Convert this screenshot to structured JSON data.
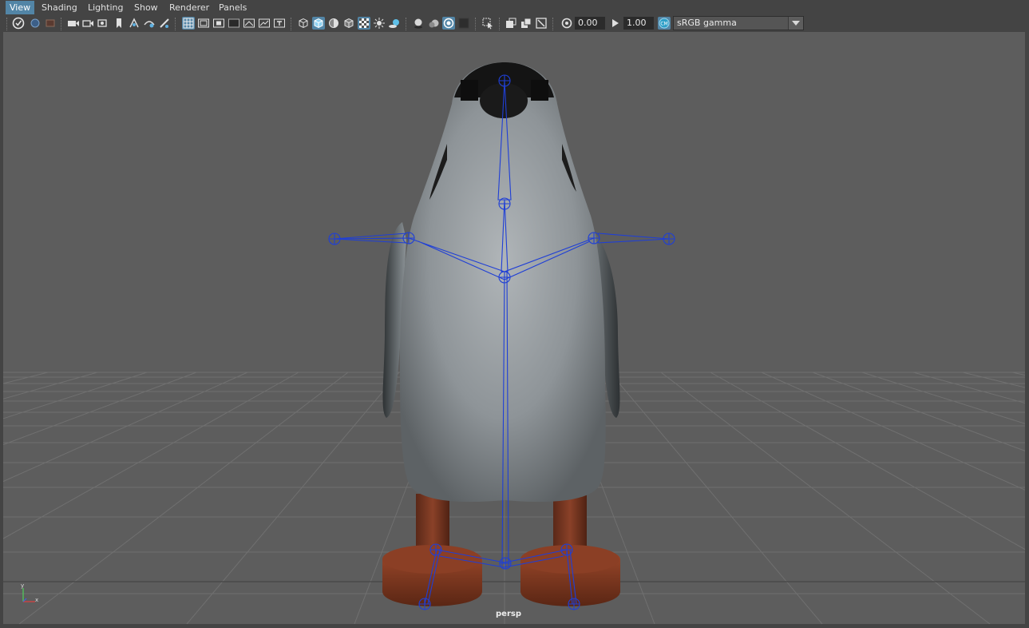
{
  "menubar": {
    "items": [
      "View",
      "Shading",
      "Lighting",
      "Show",
      "Renderer",
      "Panels"
    ],
    "active": "View"
  },
  "toolbar": {
    "near_clip": "0.00",
    "far_clip": "1.00",
    "color_space": "sRGB gamma",
    "icons": [
      "select-camera-icon",
      "lock-camera-icon",
      "bookmark-icon",
      "camera-attributes-icon",
      "image-plane-icon",
      "2d-pan-zoom-icon",
      "grease-pencil-icon",
      "grid-icon",
      "film-gate-icon",
      "resolution-gate-icon",
      "gate-mask-icon",
      "field-chart-icon",
      "safe-action-icon",
      "safe-title-icon",
      "wireframe-icon",
      "smooth-shade-icon",
      "default-material-icon",
      "wireframe-on-shaded-icon",
      "textured-icon",
      "use-lights-icon",
      "shadows-icon",
      "ambient-occlusion-icon",
      "motion-blur-icon",
      "anti-aliasing-icon",
      "depth-of-field-icon",
      "isolate-select-icon",
      "xray-icon",
      "xray-joints-icon",
      "xray-components-icon",
      "exposure-icon",
      "gamma-icon",
      "color-management-icon"
    ]
  },
  "viewport": {
    "camera": "persp",
    "axis": {
      "x": "x",
      "y": "y"
    },
    "colors": {
      "background": "#5d5d5d",
      "grid": "#6e6e6e",
      "grid_axis": "#4a4a4a",
      "joint": "#1f3fd6",
      "body_fur": "#8f969a",
      "leg": "#7a3a24"
    }
  }
}
